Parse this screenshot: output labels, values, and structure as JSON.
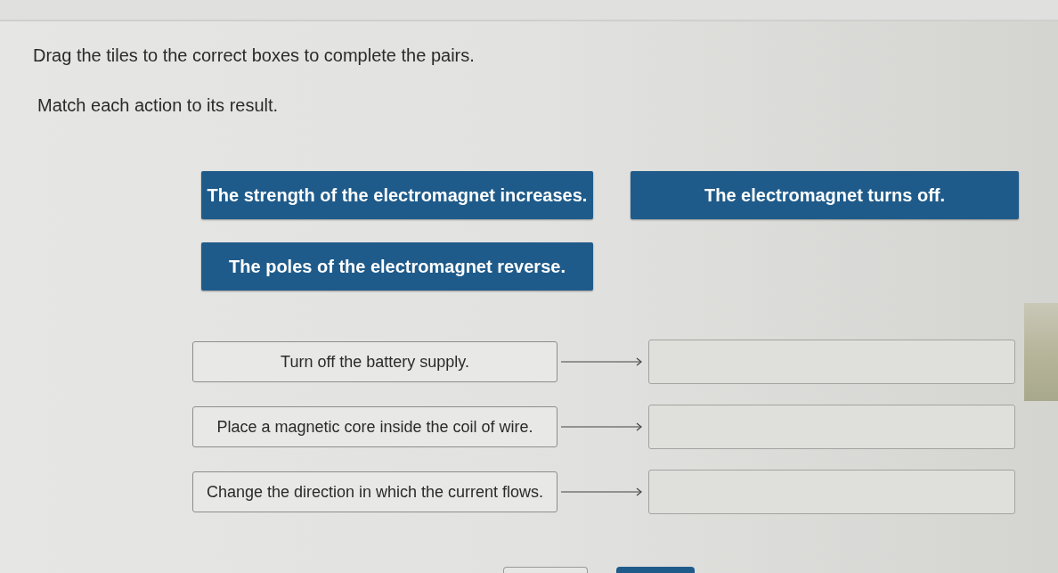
{
  "instructions": [
    "Drag the tiles to the correct boxes to complete the pairs.",
    "Match each action to its result."
  ],
  "tiles": [
    "The strength of the electromagnet increases.",
    "The electromagnet turns off.",
    "The poles of the electromagnet reverse."
  ],
  "pairs": [
    {
      "action": "Turn off the battery supply."
    },
    {
      "action": "Place a magnetic core inside the coil of wire."
    },
    {
      "action": "Change the direction in which the current flows."
    }
  ],
  "buttons": [
    {
      "kind": "outlined"
    },
    {
      "kind": "filled"
    }
  ]
}
